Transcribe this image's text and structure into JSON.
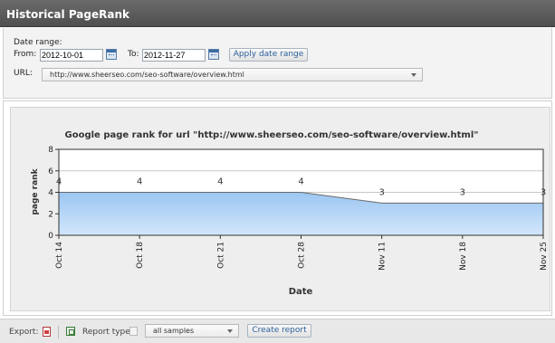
{
  "header": {
    "title": "Historical PageRank"
  },
  "filters": {
    "date_range_label": "Date range:",
    "from_label": "From:",
    "from_value": "2012-10-01",
    "to_label": "To:",
    "to_value": "2012-11-27",
    "apply_label": "Apply date range",
    "url_label": "URL:",
    "url_value": "http://www.sheerseo.com/seo-software/overview.html"
  },
  "chart_data": {
    "type": "area",
    "title": "Google page rank for url \"http://www.sheerseo.com/seo-software/overview.html\"",
    "xlabel": "Date",
    "ylabel": "page rank",
    "ylim": [
      0,
      8
    ],
    "yticks": [
      0,
      2,
      4,
      6,
      8
    ],
    "categories": [
      "Oct 14",
      "Oct 18",
      "Oct 21",
      "Oct 28",
      "Nov 11",
      "Nov 18",
      "Nov 25"
    ],
    "series": [
      {
        "values": [
          4,
          4,
          4,
          4,
          3,
          3,
          3
        ]
      }
    ],
    "data_labels": [
      "4",
      "4",
      "4",
      "4",
      "3",
      "3",
      "3"
    ],
    "grid": true,
    "colors": {
      "fill_top": "#9cc6f2",
      "fill_bottom": "#d2e6fb",
      "line": "#6a6a6a"
    }
  },
  "footer": {
    "export_label": "Export:",
    "report_type_label": "Report type:",
    "report_type_value": "all samples",
    "create_label": "Create report"
  },
  "icons": [
    "calendar-icon",
    "calendar-icon",
    "pdf-icon",
    "excel-icon",
    "help-icon",
    "chevron-down-icon"
  ]
}
